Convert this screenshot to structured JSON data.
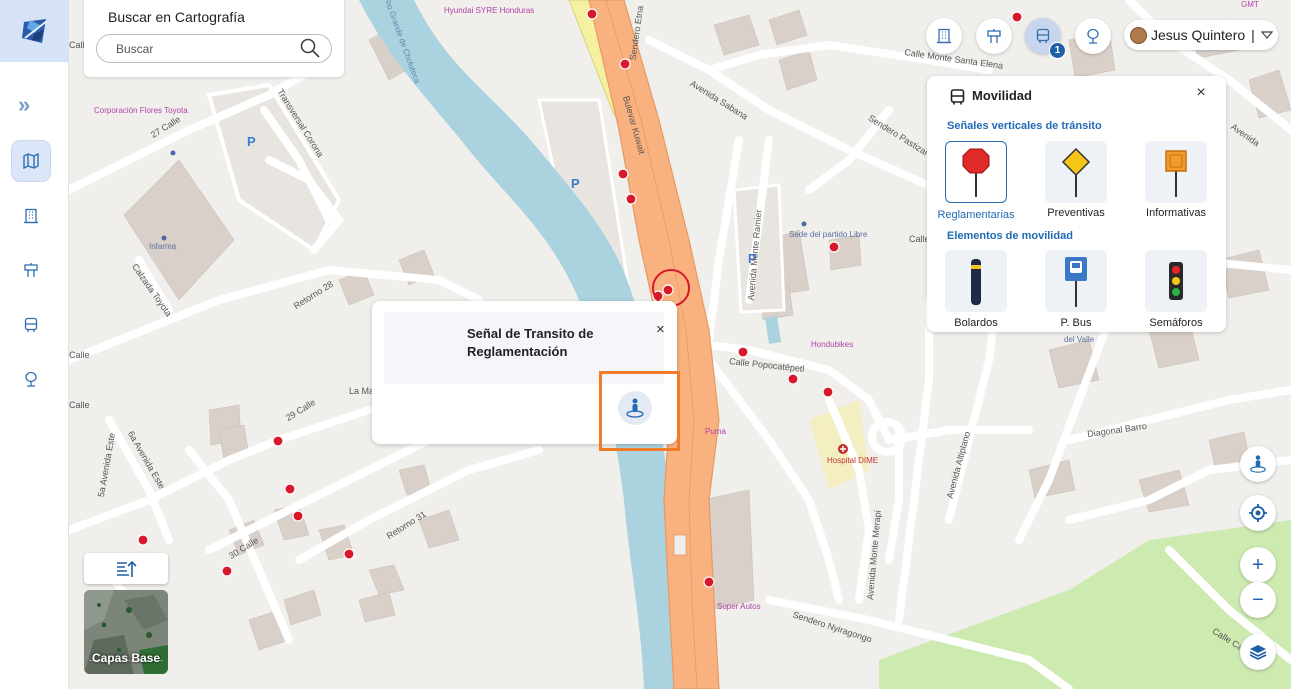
{
  "search": {
    "title": "Buscar en Cartografía",
    "placeholder": "Buscar"
  },
  "top_buttons": [
    {
      "icon": "building-icon"
    },
    {
      "icon": "signpost-icon"
    },
    {
      "icon": "bus-icon",
      "active": true,
      "badge": "1"
    },
    {
      "icon": "tree-icon"
    }
  ],
  "user": {
    "name": "Jesus Quintero",
    "separator": "|"
  },
  "sidebar": {
    "items": [
      {
        "icon": "expand-chevrons-icon"
      },
      {
        "icon": "map-icon",
        "active": true
      },
      {
        "icon": "building-icon"
      },
      {
        "icon": "signpost-icon"
      },
      {
        "icon": "bus-icon"
      },
      {
        "icon": "tree-icon"
      }
    ]
  },
  "panel": {
    "title": "Movilidad",
    "sections": [
      {
        "title": "Señales verticales de tránsito",
        "items": [
          {
            "label": "Reglamentarias",
            "icon": "stop-sign-icon",
            "selected": true
          },
          {
            "label": "Preventivas",
            "icon": "warning-sign-icon"
          },
          {
            "label": "Informativas",
            "icon": "info-sign-icon"
          }
        ]
      },
      {
        "title": "Elementos de movilidad",
        "items": [
          {
            "label": "Bolardos",
            "icon": "bollard-icon"
          },
          {
            "label": "P. Bus",
            "icon": "bus-stop-icon"
          },
          {
            "label": "Semáforos",
            "icon": "traffic-light-icon"
          }
        ]
      }
    ]
  },
  "popup": {
    "title": "Señal de Transito de Reglamentación",
    "close": "×",
    "action_icon": "street-view-icon"
  },
  "map_controls": {
    "zoom_in": "+",
    "zoom_out": "−"
  },
  "base_layers": {
    "label": "Capas Base"
  },
  "map": {
    "streets": [
      "Calle Monte Santa Elena",
      "Avenida Sabana",
      "Sendero Pastizal",
      "Bulevar Kuwait",
      "Sendero Etna",
      "Transversal Corona",
      "27 Calle",
      "Retorno 28",
      "29 Calle",
      "30 Calle",
      "Retorno 31",
      "5a Avenida Este",
      "6a Avenida Este",
      "Calzada Toyota",
      "Calle Popocatépetl",
      "Avenida Monte Ramier",
      "Avenida Monte Merapi",
      "Avenida Altiplano",
      "Diagonal Barro",
      "Sendero Nyiragongo",
      "Calle Camelia",
      "Calle",
      "Calle",
      "Calle",
      "Calle Go",
      "La Ma",
      "Avenida",
      "Rio Grande de Choluteca"
    ],
    "pois": [
      "Corporación Flores Toyota",
      "Infarma",
      "Hyundai SYRE Honduras",
      "Sede del partido Libre",
      "Hondubikes",
      "Puma",
      "Hospital DIME",
      "Super Autos",
      "GMT",
      "del Valle"
    ],
    "parking": "P",
    "colors": {
      "river": "#aad3df",
      "primary_road": "#f9b27f",
      "secondary_road": "#f6f1a1",
      "park": "#cdebb0",
      "building": "#d9d0c9",
      "signal": "#d8172b",
      "accent": "#1f5fa7",
      "highlight": "#f07c2a"
    }
  }
}
